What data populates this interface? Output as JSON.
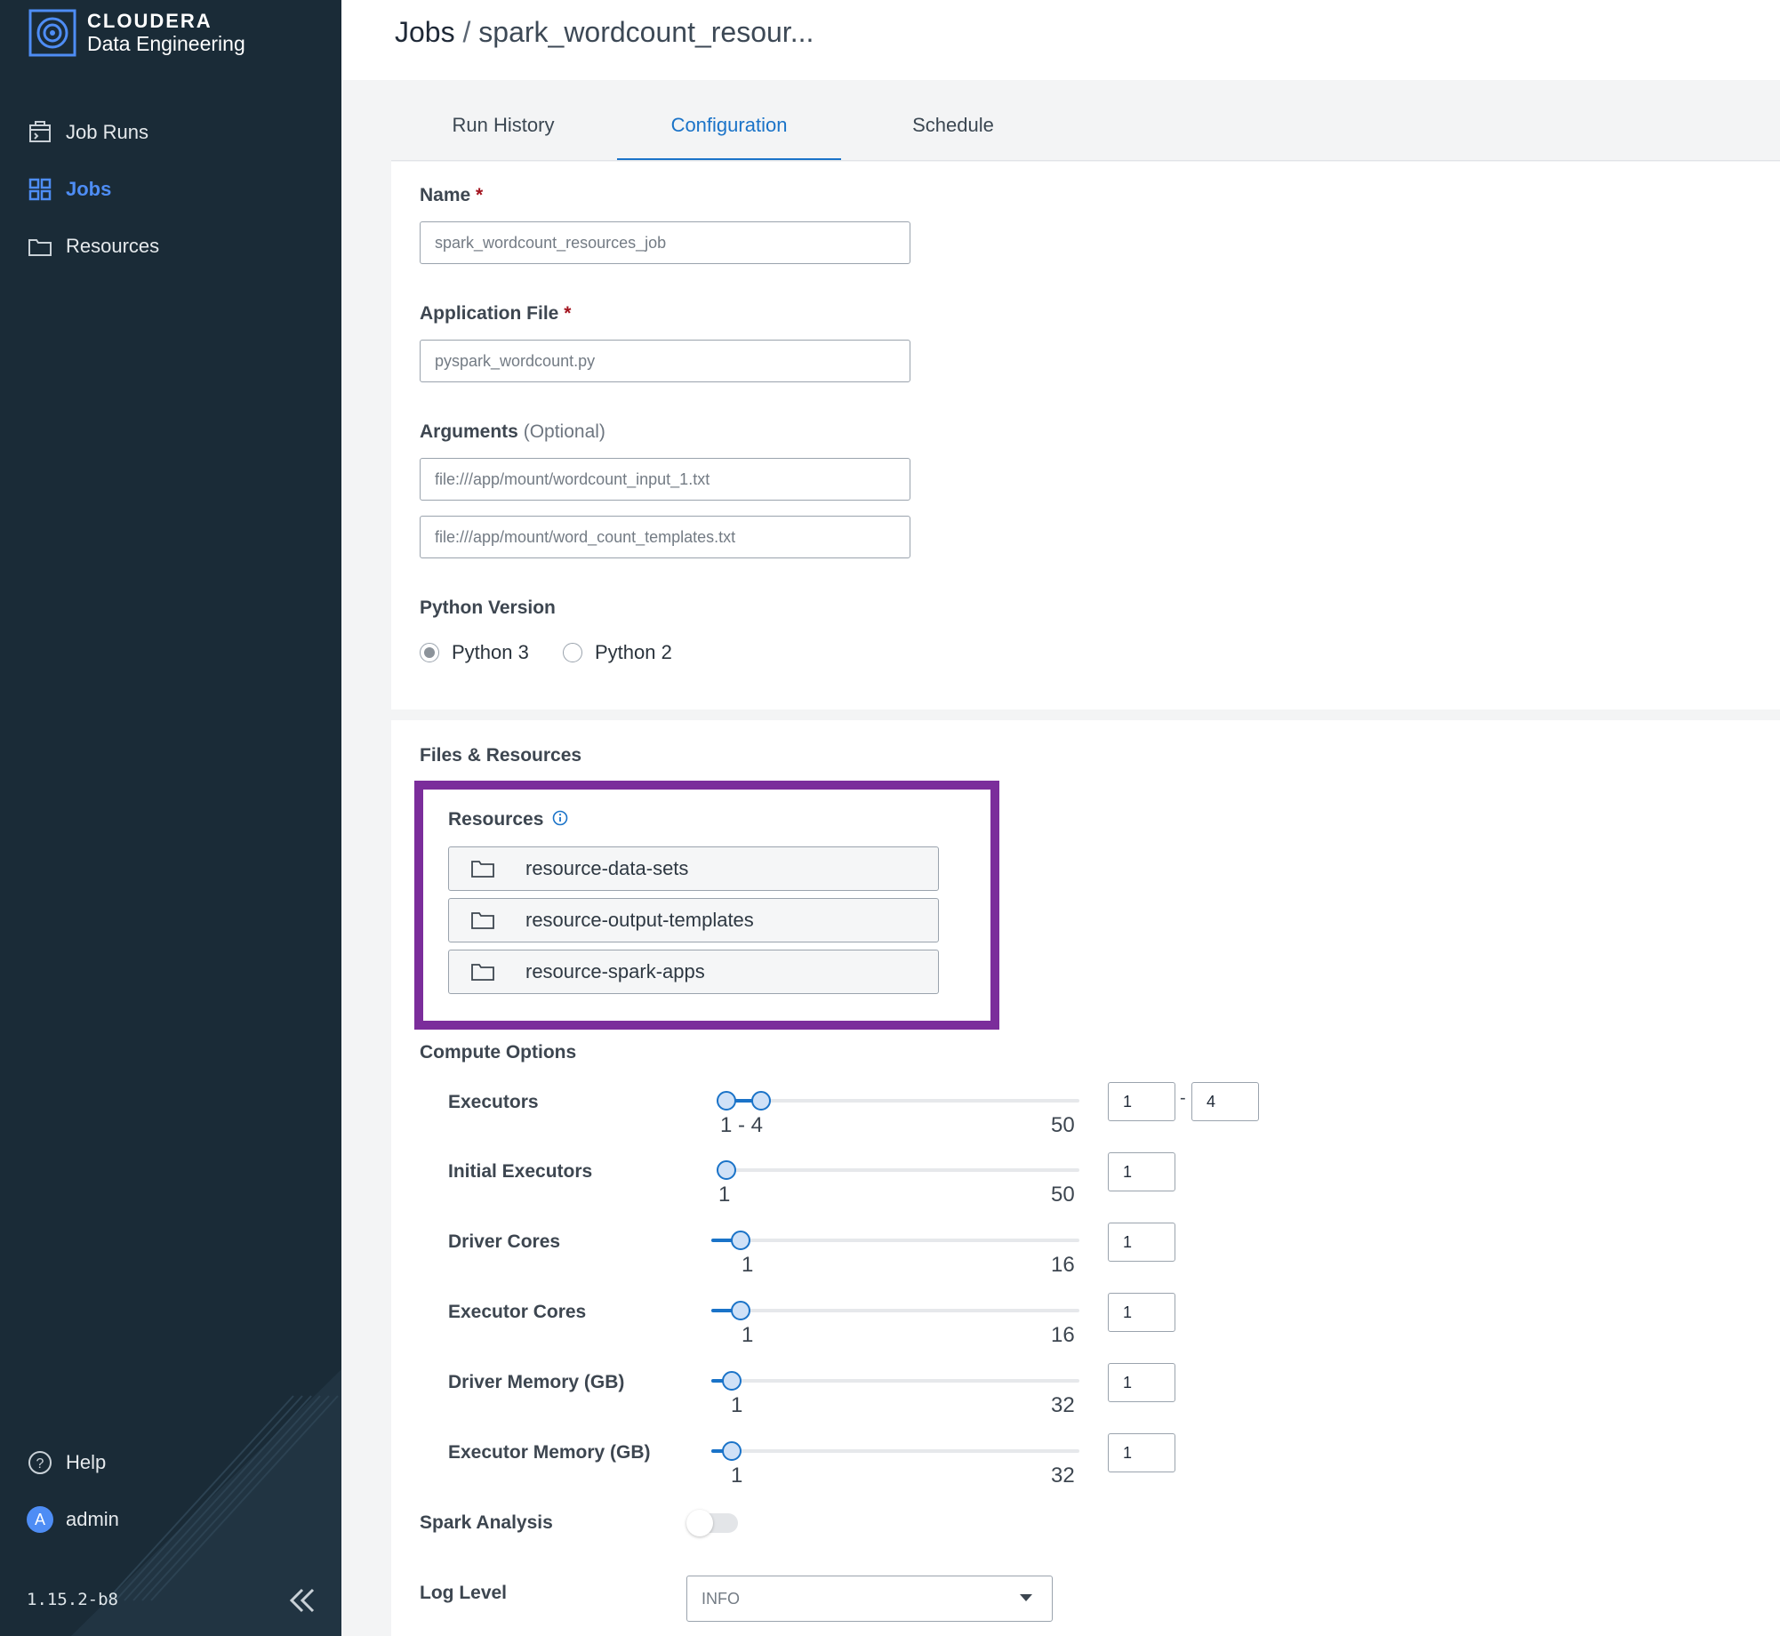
{
  "sidebar": {
    "brand": "CLOUDERA",
    "product": "Data Engineering",
    "nav": [
      {
        "label": "Job Runs",
        "icon": "job-runs-icon"
      },
      {
        "label": "Jobs",
        "icon": "grid-icon",
        "active": true
      },
      {
        "label": "Resources",
        "icon": "folder-icon"
      }
    ],
    "help_label": "Help",
    "user_initial": "A",
    "user_label": "admin",
    "version": "1.15.2-b8"
  },
  "header": {
    "breadcrumb_root": "Jobs",
    "breadcrumb_sep": "/",
    "breadcrumb_current": "spark_wordcount_resour..."
  },
  "tabs": [
    {
      "label": "Run History"
    },
    {
      "label": "Configuration",
      "active": true
    },
    {
      "label": "Schedule"
    }
  ],
  "form": {
    "name_label": "Name",
    "required_mark": "*",
    "name_value": "spark_wordcount_resources_job",
    "app_file_label": "Application File",
    "app_file_value": "pyspark_wordcount.py",
    "arguments_label": "Arguments",
    "arguments_optional": "(Optional)",
    "arguments": [
      "file:///app/mount/wordcount_input_1.txt",
      "file:///app/mount/word_count_templates.txt"
    ],
    "python_version_label": "Python Version",
    "python_options": [
      {
        "label": "Python 3",
        "selected": true
      },
      {
        "label": "Python 2",
        "selected": false
      }
    ]
  },
  "files_resources": {
    "section_title": "Files & Resources",
    "resources_label": "Resources",
    "items": [
      "resource-data-sets",
      "resource-output-templates",
      "resource-spark-apps"
    ]
  },
  "compute": {
    "section_title": "Compute Options",
    "executors": {
      "label": "Executors",
      "range_label": "1 - 4",
      "min": 1,
      "max": 50,
      "low": 1,
      "high": 4
    },
    "sliders": [
      {
        "label": "Initial Executors",
        "min": 1,
        "max": 50,
        "value": 1,
        "input": "1"
      },
      {
        "label": "Driver Cores",
        "min": 1,
        "max": 16,
        "value": 1,
        "input": "1"
      },
      {
        "label": "Executor Cores",
        "min": 1,
        "max": 16,
        "value": 1,
        "input": "1"
      },
      {
        "label": "Driver Memory (GB)",
        "min": 1,
        "max": 32,
        "value": 1,
        "input": "1"
      },
      {
        "label": "Executor Memory (GB)",
        "min": 1,
        "max": 32,
        "value": 1,
        "input": "1"
      }
    ],
    "executors_min_input": "1",
    "executors_range_dash": "-",
    "executors_max_input": "4",
    "spark_analysis_label": "Spark Analysis",
    "spark_analysis_enabled": false,
    "log_level_label": "Log Level",
    "log_level_value": "INFO"
  },
  "colors": {
    "sidebar_bg": "#1a2b37",
    "accent": "#1a73c8",
    "active_nav": "#4e8df5",
    "highlight_border": "#7b2d9b"
  }
}
